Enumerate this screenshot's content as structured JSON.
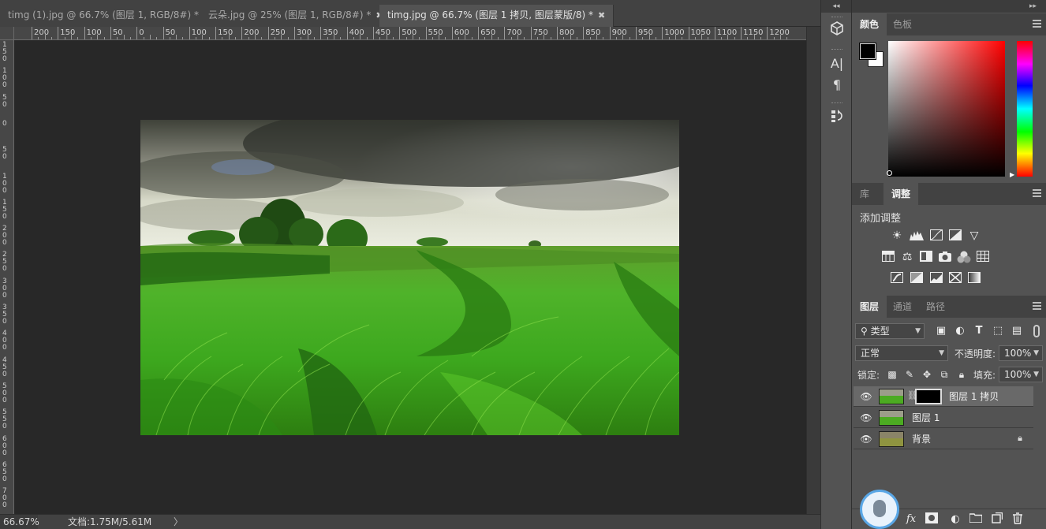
{
  "tabs": [
    {
      "label": "timg (1).jpg @ 66.7% (图层 1, RGB/8#) *",
      "close": "✖"
    },
    {
      "label": "云朵.jpg @ 25% (图层 1, RGB/8#) *",
      "close": "✖"
    },
    {
      "label": "timg.jpg @ 66.7% (图层 1 拷贝, 图层蒙版/8) *",
      "close": "✖"
    }
  ],
  "ruler_h": [
    "200",
    "150",
    "100",
    "50",
    "0",
    "50",
    "100",
    "150",
    "200",
    "250",
    "300",
    "350",
    "400",
    "450",
    "500",
    "550",
    "600",
    "650",
    "700",
    "750",
    "800",
    "850",
    "900",
    "950",
    "1000",
    "1050",
    "1100",
    "1150",
    "1200"
  ],
  "ruler_v": [
    "150",
    "100",
    "50",
    "0",
    "50",
    "100",
    "150",
    "200",
    "250",
    "300",
    "350",
    "400",
    "450",
    "500",
    "550",
    "600",
    "650",
    "700"
  ],
  "status": {
    "zoom": "66.67%",
    "doc_info": "文档:1.75M/5.61M",
    "menu_arrow": "〉"
  },
  "collapse_glyph": "◂◂",
  "expand_glyph": "▸▸",
  "color_panel": {
    "tabs": [
      "颜色",
      "色板"
    ],
    "foreground": "#000000",
    "background": "#ffffff"
  },
  "adjust_panel": {
    "tabs": [
      "库",
      "调整"
    ],
    "title": "添加调整",
    "rows": [
      [
        "brightness-contrast-icon",
        "levels-icon",
        "curves-icon",
        "exposure-icon",
        "vibrance-icon"
      ],
      [
        "hue-saturation-icon",
        "color-balance-icon",
        "black-white-icon",
        "photo-filter-icon",
        "channel-mixer-icon",
        "color-lookup-icon"
      ],
      [
        "invert-icon",
        "posterize-icon",
        "threshold-icon",
        "selective-color-icon",
        "gradient-map-icon"
      ]
    ]
  },
  "layers_panel": {
    "tabs": [
      "图层",
      "通道",
      "路径"
    ],
    "filter_label": "类型",
    "blend_mode": "正常",
    "opacity_label": "不透明度:",
    "opacity_value": "100%",
    "lock_label": "锁定:",
    "fill_label": "填充:",
    "fill_value": "100%",
    "layers": [
      {
        "name": "图层 1 拷贝",
        "selected": true,
        "has_mask": true
      },
      {
        "name": "图层 1",
        "selected": false,
        "has_mask": false
      },
      {
        "name": "背景",
        "selected": false,
        "locked": true
      }
    ],
    "footer_fx": "fx"
  }
}
